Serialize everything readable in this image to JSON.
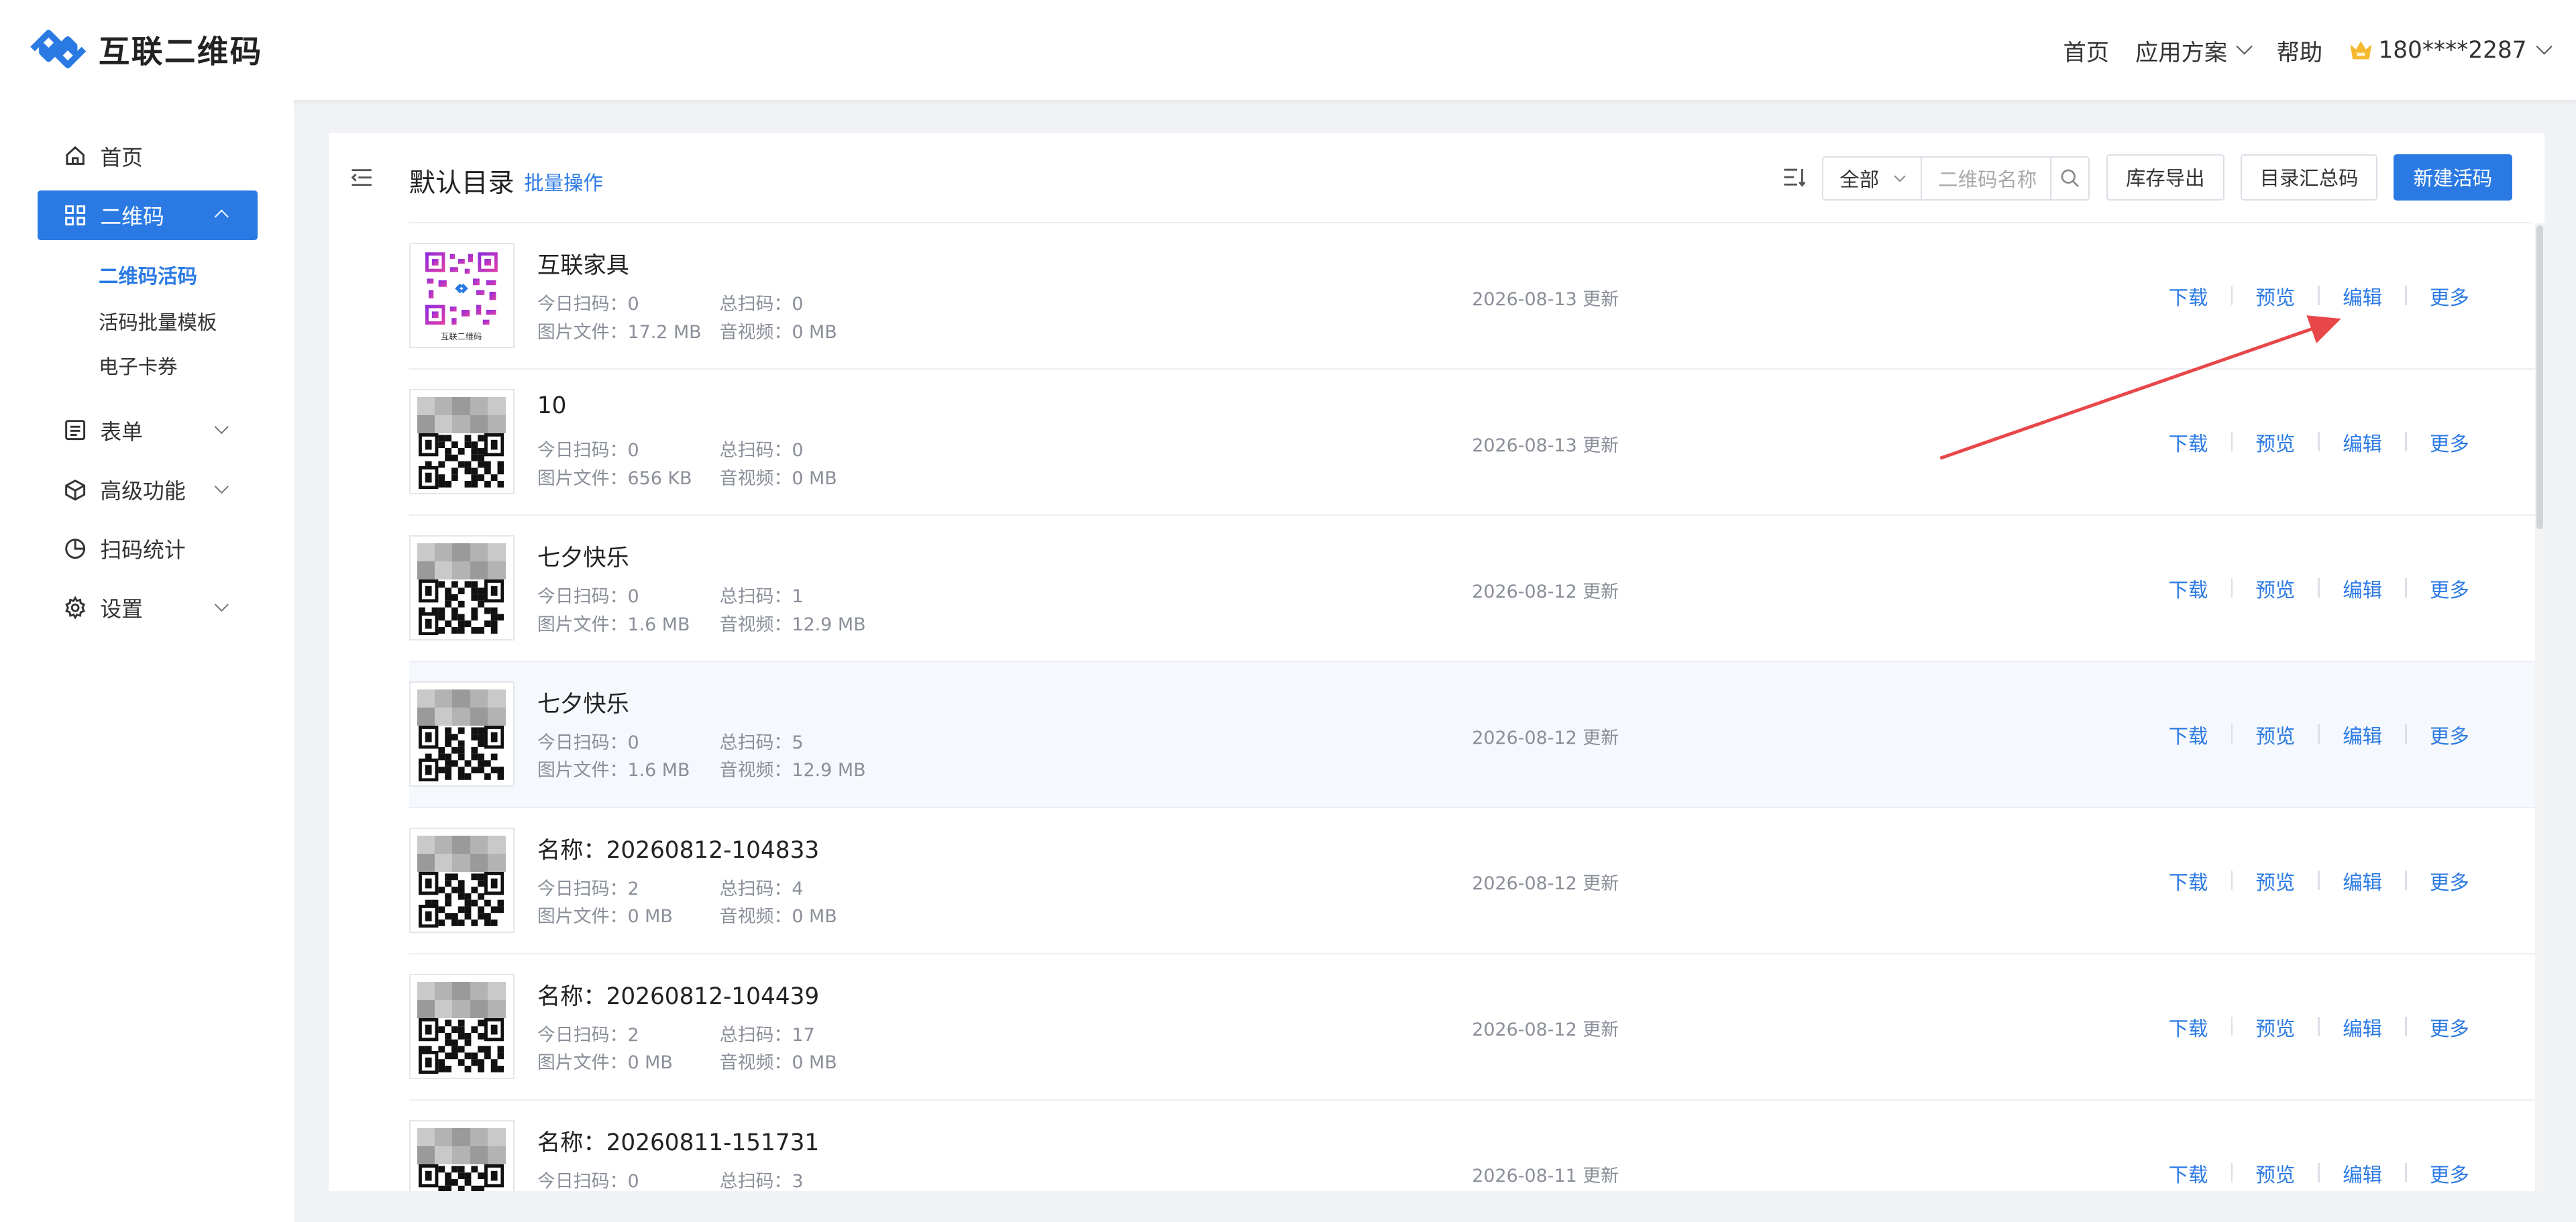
{
  "app": {
    "title": "互联二维码"
  },
  "topnav": {
    "home": "首页",
    "solutions": "应用方案",
    "help": "帮助",
    "user": "180****2287"
  },
  "sidebar": {
    "items": [
      {
        "label": "首页"
      },
      {
        "label": "二维码"
      },
      {
        "label": "表单"
      },
      {
        "label": "高级功能"
      },
      {
        "label": "扫码统计"
      },
      {
        "label": "设置"
      }
    ],
    "sub_items": [
      "二维码活码",
      "活码批量模板",
      "电子卡券"
    ]
  },
  "toolbar": {
    "title": "默认目录",
    "batch": "批量操作",
    "filter_select": "全部",
    "search_placeholder": "二维码名称",
    "export": "库存导出",
    "summary": "目录汇总码",
    "create": "新建活码"
  },
  "labels": {
    "today": "今日扫码：",
    "total": "总扫码：",
    "image": "图片文件：",
    "audio": "音视频：",
    "updated": "更新"
  },
  "actions": {
    "download": "下载",
    "preview": "预览",
    "edit": "编辑",
    "more": "更多"
  },
  "colors": {
    "accent": "#2b7ae4",
    "annotation_arrow": "#e8474a"
  },
  "rows": [
    {
      "name": "互联家具",
      "today": "0",
      "total": "0",
      "image": "17.2 MB",
      "audio": "0 MB",
      "date": "2026-08-13 更新",
      "thumb_caption": "互联二维码",
      "thumb_type": "colored"
    },
    {
      "name": "10",
      "today": "0",
      "total": "0",
      "image": "656 KB",
      "audio": "0 MB",
      "date": "2026-08-13 更新",
      "thumb_type": "blurred"
    },
    {
      "name": "七夕快乐",
      "today": "0",
      "total": "1",
      "image": "1.6 MB",
      "audio": "12.9 MB",
      "date": "2026-08-12 更新",
      "thumb_type": "blurred"
    },
    {
      "name": "七夕快乐",
      "today": "0",
      "total": "5",
      "image": "1.6 MB",
      "audio": "12.9 MB",
      "date": "2026-08-12 更新",
      "thumb_type": "blurred"
    },
    {
      "name": "名称：20260812-104833",
      "today": "2",
      "total": "4",
      "image": "0 MB",
      "audio": "0 MB",
      "date": "2026-08-12 更新",
      "thumb_type": "blurred"
    },
    {
      "name": "名称：20260812-104439",
      "today": "2",
      "total": "17",
      "image": "0 MB",
      "audio": "0 MB",
      "date": "2026-08-12 更新",
      "thumb_type": "blurred"
    },
    {
      "name": "名称：20260811-151731",
      "today": "0",
      "total": "3",
      "image": "",
      "audio": "",
      "date": "2026-08-11 更新",
      "thumb_type": "blurred"
    }
  ]
}
